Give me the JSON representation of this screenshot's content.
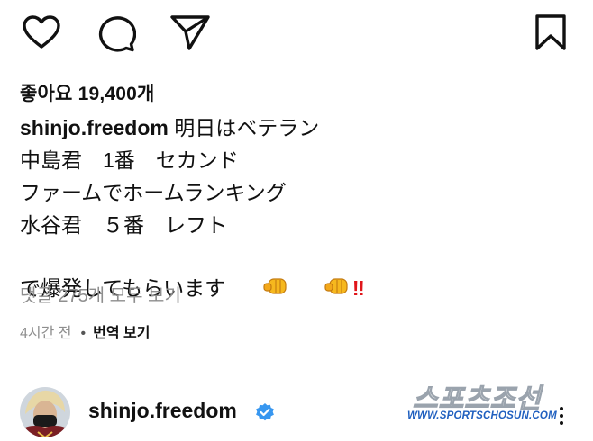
{
  "actions": {
    "like_icon": "heart-icon",
    "comment_icon": "speech-bubble-icon",
    "share_icon": "paper-plane-icon",
    "save_icon": "bookmark-icon"
  },
  "likes": {
    "text": "좋아요 19,400개"
  },
  "caption": {
    "username": "shinjo.freedom",
    "lines": [
      "明日はベテラン",
      "中島君　1番　セカンド",
      "ファームでホームランキング",
      "水谷君　５番　レフト",
      "で爆発してもらいます"
    ],
    "emoji": [
      "oncoming-fist",
      "oncoming-fist",
      "double-exclamation"
    ],
    "exclaim": "‼"
  },
  "comments": {
    "view_all": "댓글 275개 모두 보기"
  },
  "meta": {
    "time": "4시간 전",
    "translate": "번역 보기"
  },
  "author": {
    "username": "shinjo.freedom",
    "verified": true
  },
  "watermark": {
    "logo": "스포츠조선",
    "url": "WWW.SPORTSCHOSUN.COM"
  },
  "colors": {
    "verified": "#3897f0",
    "exclaim": "#e0161b",
    "muted": "#8e8e8e",
    "watermark_url": "#1f5fbf"
  }
}
